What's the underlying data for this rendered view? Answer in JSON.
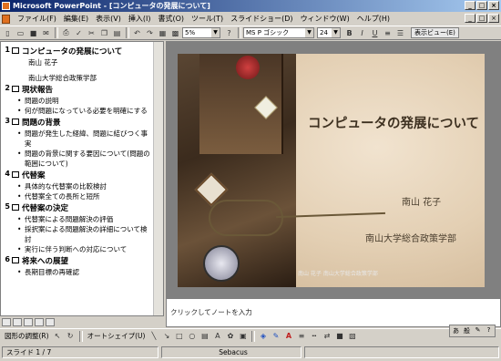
{
  "window": {
    "title": "Microsoft PowerPoint - [コンピュータの発展について]",
    "controls": [
      "_",
      "□",
      "×"
    ]
  },
  "menu": {
    "items": [
      "ファイル(F)",
      "編集(E)",
      "表示(V)",
      "挿入(I)",
      "書式(O)",
      "ツール(T)",
      "スライドショー(D)",
      "ウィンドウ(W)",
      "ヘルプ(H)"
    ]
  },
  "toolbar": {
    "zoom": "5%",
    "font": "MS P ゴシック",
    "font_size": "24",
    "extra_label": "表示ビュー(E)"
  },
  "outline": {
    "slides": [
      {
        "num": "1",
        "title": "コンピュータの発展について",
        "lines": [
          "南山 花子",
          "",
          "南山大学総合政策学部"
        ],
        "bullets": []
      },
      {
        "num": "2",
        "title": "現状報告",
        "lines": [],
        "bullets": [
          "問題の説明",
          "何が問題になっている必要を明確にする"
        ]
      },
      {
        "num": "3",
        "title": "問題の背景",
        "lines": [],
        "bullets": [
          "問題が発生した経緯、問題に結びつく事実",
          "問題の背景に関する要因について(問題の範囲について)"
        ]
      },
      {
        "num": "4",
        "title": "代替案",
        "lines": [],
        "bullets": [
          "具体的な代替案の比較検討",
          "代替案全ての長所と短所"
        ]
      },
      {
        "num": "5",
        "title": "代替案の決定",
        "lines": [],
        "bullets": [
          "代替案による問題解決の評価",
          "採択案による問題解決の詳細について検討",
          "実行に伴う判断への対応について"
        ]
      },
      {
        "num": "6",
        "title": "将来への展望",
        "lines": [],
        "bullets": [
          "長期目標の再確認"
        ]
      }
    ]
  },
  "slide": {
    "title": "コンピュータの発展について",
    "author": "南山 花子",
    "affiliation": "南山大学総合政策学部",
    "caption": "南山 花子 南山大学総合政策学部"
  },
  "notes": {
    "placeholder": "クリックしてノートを入力"
  },
  "drawing": {
    "draw_label": "図形の調整(R)",
    "autoshapes": "オートシェイプ(U)"
  },
  "status": {
    "slide_indicator": "スライド 1 / 7",
    "design": "Sebacus"
  }
}
